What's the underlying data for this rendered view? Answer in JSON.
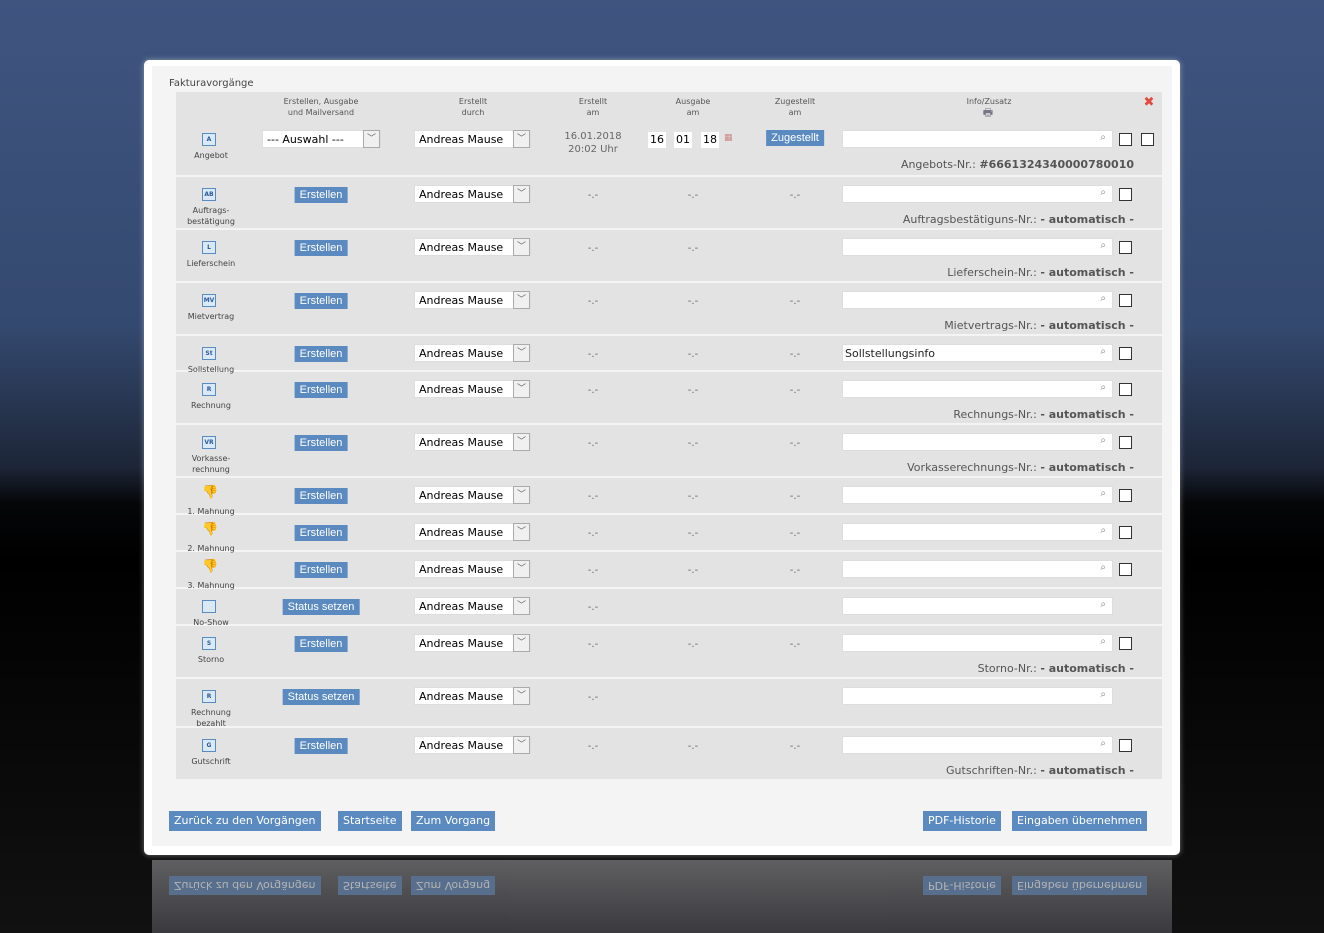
{
  "title": "Fakturavorgänge",
  "headers": {
    "action": "Erstellen, Ausgabe\nund Mailversand",
    "by": "Erstellt\ndurch",
    "created": "Erstellt\nam",
    "issued": "Ausgabe\nam",
    "delivered": "Zugestellt\nam",
    "info": "Info/Zusatz"
  },
  "rows": [
    {
      "label": "Angebot",
      "icon": "A",
      "action": "--- Auswahl ---",
      "action_type": "select",
      "user": "Andreas Mause",
      "created": "16.01.2018\n20:02 Uhr",
      "issued": [
        "16",
        "01",
        "18"
      ],
      "delivered": "Zugestellt",
      "info": "",
      "nr_label": "Angebots-Nr.:",
      "nr_value": "#6661324340000780010",
      "checks": 2
    },
    {
      "label": "Auftrags-\nbestätigung",
      "icon": "AB",
      "action": "Erstellen",
      "user": "Andreas Mause",
      "created": "-.-",
      "issued": "-.-",
      "delivered": "-.-",
      "info": "",
      "nr_label": "Auftragsbestätiguns-Nr.:",
      "nr_value": "- automatisch -",
      "checks": 1
    },
    {
      "label": "Lieferschein",
      "icon": "L",
      "action": "Erstellen",
      "user": "Andreas Mause",
      "created": "-.-",
      "issued": "-.-",
      "delivered": "",
      "info": "",
      "nr_label": "Lieferschein-Nr.:",
      "nr_value": "- automatisch -",
      "checks": 1
    },
    {
      "label": "Mietvertrag",
      "icon": "MV",
      "action": "Erstellen",
      "user": "Andreas Mause",
      "created": "-.-",
      "issued": "-.-",
      "delivered": "-.-",
      "info": "",
      "nr_label": "Mietvertrags-Nr.:",
      "nr_value": "- automatisch -",
      "checks": 1
    },
    {
      "label": "Sollstellung",
      "icon": "St",
      "action": "Erstellen",
      "user": "Andreas Mause",
      "created": "-.-",
      "issued": "-.-",
      "delivered": "-.-",
      "info": "Sollstellungsinfo",
      "checks": 1
    },
    {
      "label": "Rechnung",
      "icon": "R",
      "action": "Erstellen",
      "user": "Andreas Mause",
      "created": "-.-",
      "issued": "-.-",
      "delivered": "-.-",
      "info": "",
      "nr_label": "Rechnungs-Nr.:",
      "nr_value": "- automatisch -",
      "checks": 1
    },
    {
      "label": "Vorkasse-\nrechnung",
      "icon": "VR",
      "action": "Erstellen",
      "user": "Andreas Mause",
      "created": "-.-",
      "issued": "-.-",
      "delivered": "-.-",
      "info": "",
      "nr_label": "Vorkasserechnungs-Nr.:",
      "nr_value": "- automatisch -",
      "checks": 1
    },
    {
      "label": "1. Mahnung",
      "icon": "thumb",
      "action": "Erstellen",
      "user": "Andreas Mause",
      "created": "-.-",
      "issued": "-.-",
      "delivered": "-.-",
      "info": "",
      "checks": 1
    },
    {
      "label": "2. Mahnung",
      "icon": "thumb",
      "action": "Erstellen",
      "user": "Andreas Mause",
      "created": "-.-",
      "issued": "-.-",
      "delivered": "-.-",
      "info": "",
      "checks": 1
    },
    {
      "label": "3. Mahnung",
      "icon": "thumb",
      "action": "Erstellen",
      "user": "Andreas Mause",
      "created": "-.-",
      "issued": "-.-",
      "delivered": "-.-",
      "info": "",
      "checks": 1
    },
    {
      "label": "No-Show",
      "icon": "NS",
      "action": "Status setzen",
      "user": "Andreas Mause",
      "created": "-.-",
      "issued": "",
      "delivered": "",
      "info": "",
      "checks": 0
    },
    {
      "label": "Storno",
      "icon": "S",
      "action": "Erstellen",
      "user": "Andreas Mause",
      "created": "-.-",
      "issued": "-.-",
      "delivered": "-.-",
      "info": "",
      "nr_label": "Storno-Nr.:",
      "nr_value": "- automatisch -",
      "checks": 1
    },
    {
      "label": "Rechnung\nbezahlt",
      "icon": "R",
      "action": "Status setzen",
      "user": "Andreas Mause",
      "created": "-.-",
      "issued": "",
      "delivered": "",
      "info": "",
      "checks": 0
    },
    {
      "label": "Gutschrift",
      "icon": "G",
      "action": "Erstellen",
      "user": "Andreas Mause",
      "created": "-.-",
      "issued": "-.-",
      "delivered": "-.-",
      "info": "",
      "nr_label": "Gutschriften-Nr.:",
      "nr_value": "- automatisch -",
      "checks": 1
    }
  ],
  "buttons": {
    "back": "Zurück zu den Vorgängen",
    "start": "Startseite",
    "process": "Zum Vorgang",
    "pdf": "PDF-Historie",
    "apply": "Eingaben übernehmen"
  }
}
